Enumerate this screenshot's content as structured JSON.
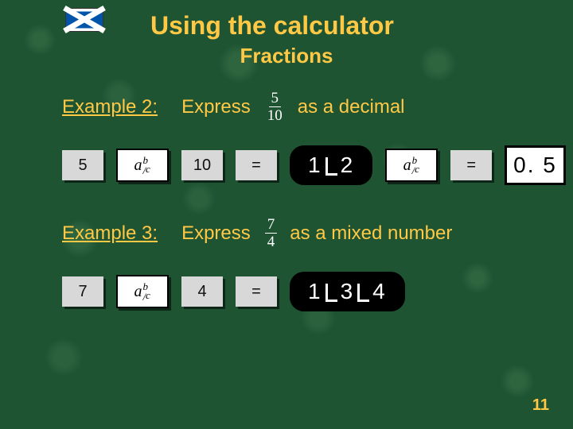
{
  "header": {
    "title": "Using the calculator",
    "subtitle": "Fractions"
  },
  "example2": {
    "label": "Example 2:",
    "express": "Express",
    "fraction": {
      "num": "5",
      "den": "10"
    },
    "after": "as a decimal",
    "keys": {
      "k1": "5",
      "k2": "10",
      "eq1": "=",
      "eq2": "="
    },
    "display": {
      "a": "1",
      "b": "2"
    },
    "result": "0. 5"
  },
  "example3": {
    "label": "Example 3:",
    "express": "Express",
    "fraction": {
      "num": "7",
      "den": "4"
    },
    "after": "as a mixed number",
    "keys": {
      "k1": "7",
      "k2": "4",
      "eq": "="
    },
    "display": {
      "a": "1",
      "b": "3",
      "c": "4"
    }
  },
  "page": "11"
}
